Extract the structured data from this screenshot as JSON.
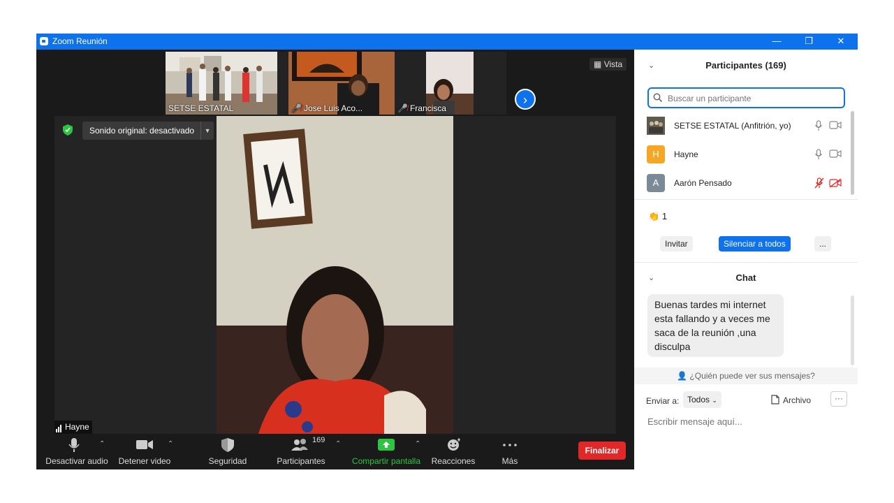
{
  "window": {
    "title": "Zoom Reunión",
    "controls": [
      "—",
      "❐",
      "✕"
    ]
  },
  "thumbnails": [
    {
      "name": "SETSE ESTATAL",
      "muted": false
    },
    {
      "name": "Jose Luis Aco...",
      "muted": true
    },
    {
      "name": "Francisca",
      "muted": true
    }
  ],
  "vista_label": "Vista",
  "sound_label": "Sonido original: desactivado",
  "speaker_name": "Hayne",
  "toolbar": {
    "audio": "Desactivar audio",
    "video": "Detener video",
    "security": "Seguridad",
    "participants": "Participantes",
    "participants_count": "169",
    "share": "Compartir pantalla",
    "reactions": "Reacciones",
    "more": "Más",
    "end": "Finalizar"
  },
  "participants_panel": {
    "title": "Participantes (169)",
    "search_placeholder": "Buscar un participante",
    "list": [
      {
        "name": "SETSE ESTATAL (Anfitrión, yo)",
        "initial": "",
        "color": "#6b6b5b",
        "muted": false
      },
      {
        "name": "Hayne",
        "initial": "H",
        "color": "#f5a623",
        "muted": false
      },
      {
        "name": "Aarón Pensado",
        "initial": "A",
        "color": "#7a8a96",
        "muted": true
      }
    ],
    "reaction_count": "1",
    "invite": "Invitar",
    "mute_all": "Silenciar a todos",
    "more": "..."
  },
  "chat": {
    "title": "Chat",
    "message": "Buenas tardes mi internet esta fallando y a veces me saca de la reunión ,una disculpa",
    "who_can_see": "¿Quién puede ver sus mensajes?",
    "send_to_label": "Enviar a:",
    "send_to_value": "Todos",
    "file_label": "Archivo",
    "more": "···",
    "input_placeholder": "Escribir mensaje aquí..."
  },
  "colors": {
    "accent": "#0e72ed",
    "end": "#e02828",
    "share": "#2dc441"
  }
}
